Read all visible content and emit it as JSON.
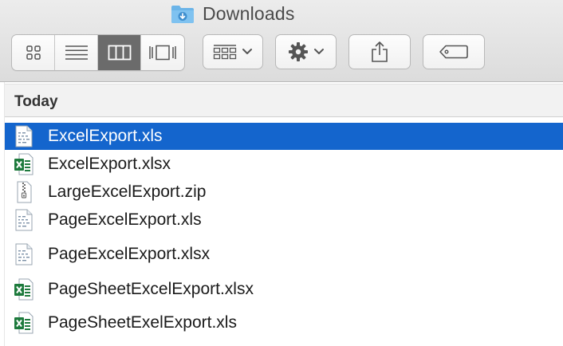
{
  "window": {
    "title": "Downloads"
  },
  "toolbar": {
    "view_modes": [
      {
        "name": "icon-view",
        "active": false
      },
      {
        "name": "list-view",
        "active": false
      },
      {
        "name": "column-view",
        "active": true
      },
      {
        "name": "cover-flow-view",
        "active": false
      }
    ],
    "arrange_icon": "arrange-grid-icon",
    "action_icon": "gear-icon",
    "share_icon": "share-icon",
    "tag_icon": "tag-icon"
  },
  "list": {
    "section_label": "Today",
    "selected_color": "#1465cd",
    "files": [
      {
        "name": "ExcelExport.xls",
        "icon": "spreadsheet-doc-icon",
        "selected": true
      },
      {
        "name": "ExcelExport.xlsx",
        "icon": "excel-icon",
        "selected": false
      },
      {
        "name": "LargeExcelExport.zip",
        "icon": "zip-icon",
        "selected": false
      },
      {
        "name": "PageExcelExport.xls",
        "icon": "spreadsheet-doc-icon",
        "selected": false
      },
      {
        "name": "PageExcelExport.xlsx",
        "icon": "spreadsheet-doc-icon",
        "selected": false
      },
      {
        "name": "PageSheetExcelExport.xlsx",
        "icon": "excel-icon",
        "selected": false
      },
      {
        "name": "PageSheetExelExport.xls",
        "icon": "excel-icon",
        "selected": false
      }
    ]
  }
}
